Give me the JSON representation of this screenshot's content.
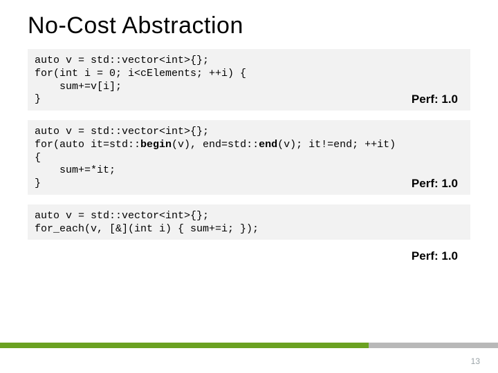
{
  "title": "No-Cost Abstraction",
  "blocks": [
    {
      "lines": [
        {
          "segments": [
            {
              "text": "auto v = std::vector<int>{};"
            }
          ]
        },
        {
          "segments": [
            {
              "text": "for(int i = 0; i<cElements; ++i) {"
            }
          ]
        },
        {
          "segments": [
            {
              "text": "    sum+=v[i];"
            }
          ]
        },
        {
          "segments": [
            {
              "text": "}"
            }
          ]
        }
      ],
      "perf": "Perf: 1.0",
      "perf_inside": true
    },
    {
      "lines": [
        {
          "segments": [
            {
              "text": "auto v = std::vector<int>{};"
            }
          ]
        },
        {
          "segments": [
            {
              "text": "for(auto it=std::"
            },
            {
              "text": "begin",
              "bold": true
            },
            {
              "text": "(v), end=std::"
            },
            {
              "text": "end",
              "bold": true
            },
            {
              "text": "(v); it!=end; ++it)"
            }
          ]
        },
        {
          "segments": [
            {
              "text": "{"
            }
          ]
        },
        {
          "segments": [
            {
              "text": "    sum+=*it;"
            }
          ]
        },
        {
          "segments": [
            {
              "text": "}"
            }
          ]
        }
      ],
      "perf": "Perf: 1.0",
      "perf_inside": true
    },
    {
      "lines": [
        {
          "segments": [
            {
              "text": "auto v = std::vector<int>{};"
            }
          ]
        },
        {
          "segments": [
            {
              "text": "for_each(v, [&](int i) { sum+=i; });"
            }
          ]
        }
      ],
      "perf": "Perf: 1.0",
      "perf_inside": false
    }
  ],
  "page_number": "13",
  "colors": {
    "accent_green": "#6aa121",
    "accent_gray": "#b8b8b8"
  }
}
